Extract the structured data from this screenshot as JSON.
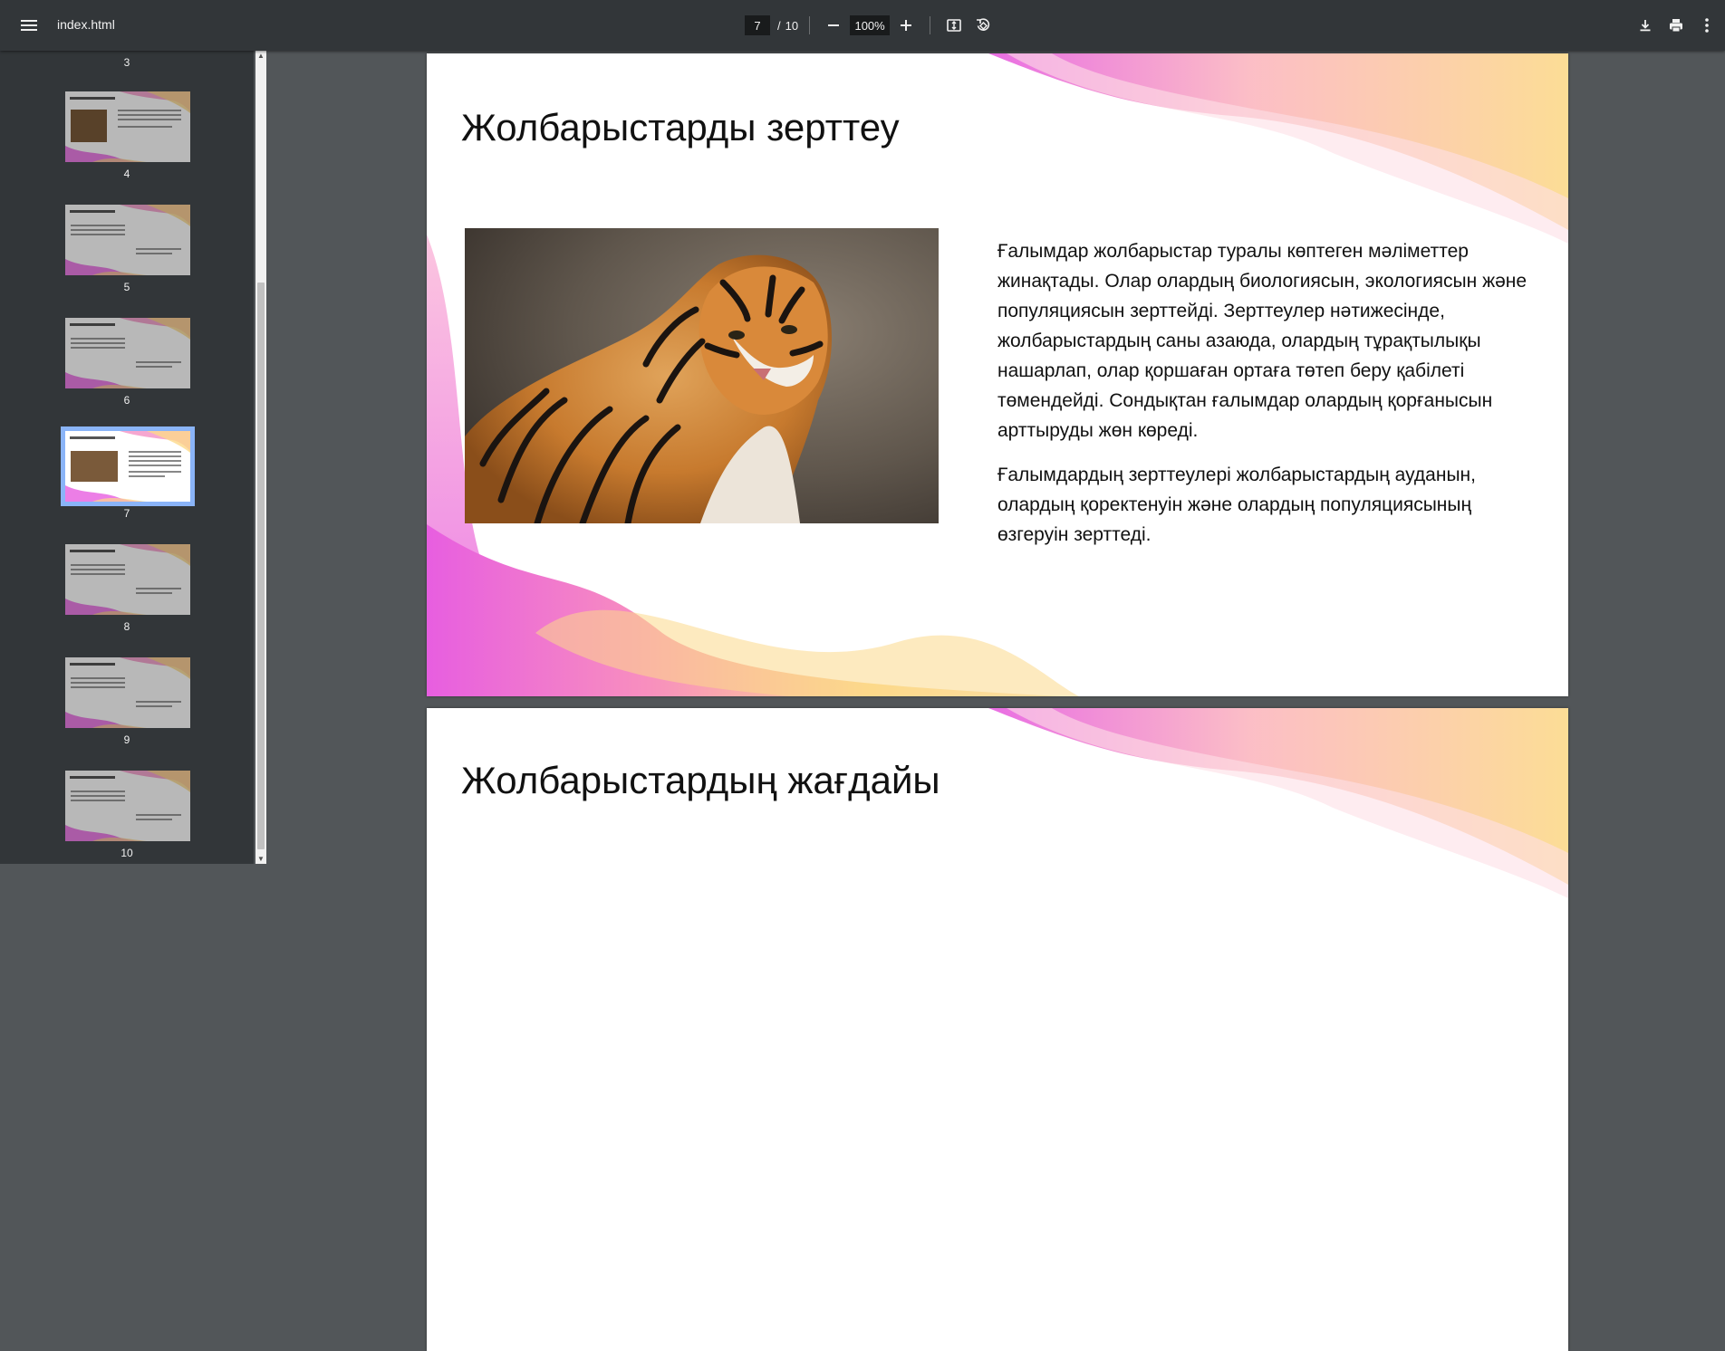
{
  "toolbar": {
    "title": "index.html",
    "current_page": "7",
    "separator": "/",
    "total_pages": "10",
    "zoom": "100%",
    "icons": [
      "menu-icon",
      "zoom-out-icon",
      "zoom-in-icon",
      "fit-page-icon",
      "rotate-icon",
      "download-icon",
      "print-icon",
      "more-vert-icon"
    ]
  },
  "sidebar": {
    "thumbnails": [
      {
        "page": "3",
        "selected": false
      },
      {
        "page": "4",
        "selected": false
      },
      {
        "page": "5",
        "selected": false
      },
      {
        "page": "6",
        "selected": false
      },
      {
        "page": "7",
        "selected": true
      },
      {
        "page": "8",
        "selected": false
      },
      {
        "page": "9",
        "selected": false
      },
      {
        "page": "10",
        "selected": false
      }
    ]
  },
  "slide7": {
    "title": "Жолбарыстарды зерттеу",
    "paragraph1": "Ғалымдар жолбарыстар туралы көптеген мәліметтер жинақтады. Олар олардың биологиясын, экологиясын және популяциясын зерттейді. Зерттеулер нәтижесінде, жолбарыстардың саны азаюда, олардың тұрақтылықы нашарлап, олар қоршаған ортаға төтеп беру қабілеті төмендейді. Сондықтан ғалымдар олардың қорғанысын арттыруды жөн көреді.",
    "paragraph2": "Ғалымдардың зерттеулері жолбарыстардың ауданын, олардың қоректенуін және олардың популяциясының өзгеруін зерттеді.",
    "image_subject": "tiger-photo"
  },
  "slide8": {
    "title": "Жолбарыстардың жағдайы"
  },
  "colors": {
    "toolbar_bg": "#323639",
    "viewer_bg": "#525659",
    "selection": "#8ab4f8",
    "wave_pink": "#e75ee0",
    "wave_peach": "#fbb7c0",
    "wave_yellow": "#fcd98a"
  }
}
